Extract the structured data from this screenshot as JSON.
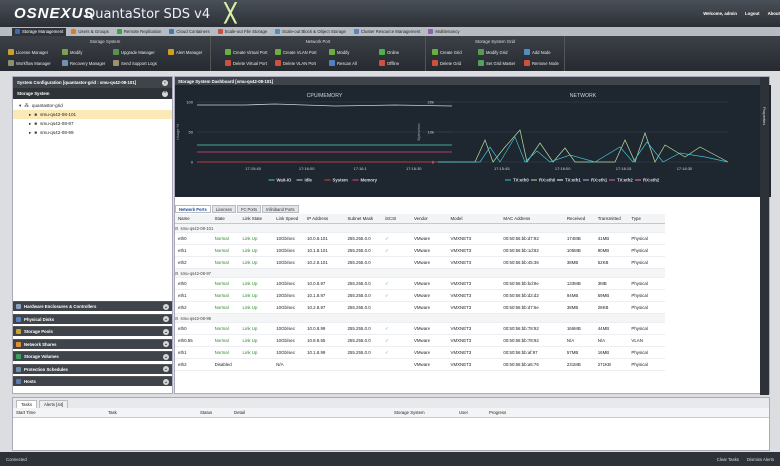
{
  "app": {
    "logo": "OSNEXUS",
    "title": "QuantaStor SDS v4",
    "welcome": "Welcome, admin",
    "logout": "Logout",
    "about": "About"
  },
  "ribbon_tabs": [
    "Storage Management",
    "Users & Groups",
    "Remote Replication",
    "Cloud Containers",
    "Scale-out File Storage",
    "Scale-out Block & Object Storage",
    "Cluster Resource Management",
    "Multitenancy"
  ],
  "ribbon": {
    "storage_system": {
      "title": "Storage System",
      "buttons": [
        "License Manager",
        "Modify",
        "Upgrade Manager",
        "Alert Manager",
        "Workflow Manager",
        "Recovery Manager",
        "Send Support Logs"
      ]
    },
    "network_port": {
      "title": "Network Port",
      "buttons": [
        "Create Virtual Port",
        "Create VLAN Port",
        "Modify",
        "Online",
        "Delete Virtual Port",
        "Delete VLAN Port",
        "Rescan All",
        "Offline"
      ]
    },
    "grid": {
      "title": "Storage System Grid",
      "buttons": [
        "Create Grid",
        "Modify Grid",
        "Add Node",
        "Delete Grid",
        "Set Grid Master",
        "Remove Node"
      ]
    }
  },
  "sidebar": {
    "title": "System Configuration [quantastor-grid : smu-qs42-08-101]",
    "section": "Storage System",
    "tree": [
      {
        "label": "quantastor-grid",
        "level": 0,
        "selected": false
      },
      {
        "label": "smu-qs42-08-101",
        "level": 1,
        "selected": true
      },
      {
        "label": "smu-qs42-08-97",
        "level": 1,
        "selected": false
      },
      {
        "label": "smu-qs42-08-99",
        "level": 1,
        "selected": false
      }
    ],
    "accordions": [
      "Hardware Enclosures & Controllers",
      "Physical Disks",
      "Storage Pools",
      "Network Shares",
      "Storage Volumes",
      "Protection Schedules",
      "Hosts"
    ]
  },
  "main": {
    "title": "Storage System Dashboard [smu-qs42-08-101]",
    "cpu_chart": {
      "title": "CPU/MEMORY",
      "ylabel": "Usage %",
      "yticks": [
        "100",
        "50",
        "0"
      ],
      "xticks": [
        "17:15:45",
        "17:16:00",
        "17:16:1",
        "17:16:30"
      ],
      "legend": [
        "Wait-IO",
        "Idle",
        "System",
        "Memory"
      ]
    },
    "net_chart": {
      "title": "NETWORK",
      "ylabel": "Bytes/sec",
      "yticks": [
        "20k",
        "10k",
        "0"
      ],
      "xticks": [
        "17:15:45",
        "17:16:00",
        "17:16:15",
        "17:16:30"
      ],
      "legend": [
        "TX:eth0",
        "RX:eth0",
        "TX:eth1",
        "RX:eth1",
        "TX:eth2",
        "RX:eth2"
      ]
    },
    "tabs": [
      "Network Ports",
      "Licenses",
      "FC Ports",
      "Infiniband Ports"
    ],
    "columns": [
      "Name",
      "State",
      "Link State",
      "Link Speed",
      "IP Address",
      "Subnet Mask",
      "iSCSI",
      "Vendor",
      "Model",
      "MAC Address",
      "Received",
      "Transmitted",
      "Type"
    ],
    "groups": [
      {
        "name": "smu-qs42-08-101",
        "rows": [
          [
            "eth0",
            "Normal",
            "Link Up",
            "10Gb/sec",
            "10.0.8.101",
            "255.255.0.0",
            "✓",
            "VMware",
            "VMXNET3",
            "00:50:56:bb:d7:92",
            "174MB",
            "41MB",
            "Physical"
          ],
          [
            "eth1",
            "Normal",
            "Link Up",
            "10Gb/sec",
            "10.1.8.101",
            "255.255.0.0",
            "✓",
            "VMware",
            "VMXNET3",
            "00:50:56:bb:1d:82",
            "105MB",
            "90MB",
            "Physical"
          ],
          [
            "eth2",
            "Normal",
            "Link Up",
            "10Gb/sec",
            "10.2.8.101",
            "255.255.0.0",
            "",
            "VMware",
            "VMXNET3",
            "00:50:56:bb:45:36",
            "38MB",
            "52KB",
            "Physical"
          ]
        ]
      },
      {
        "name": "smu-qs42-08-97",
        "rows": [
          [
            "eth0",
            "Normal",
            "Link Up",
            "10Gb/sec",
            "10.0.8.97",
            "255.255.0.0",
            "✓",
            "VMware",
            "VMXNET3",
            "00:50:56:bb:bd:9e",
            "133MB",
            "3MB",
            "Physical"
          ],
          [
            "eth1",
            "Normal",
            "Link Up",
            "10Gb/sec",
            "10.1.8.97",
            "255.255.0.0",
            "✓",
            "VMware",
            "VMXNET3",
            "00:50:56:bb:d2:d2",
            "94MB",
            "59MB",
            "Physical"
          ],
          [
            "eth2",
            "Normal",
            "Link Up",
            "10Gb/sec",
            "10.2.8.97",
            "255.255.0.0",
            "",
            "VMware",
            "VMXNET3",
            "00:50:56:bb:d7:6e",
            "38MB",
            "28KB",
            "Physical"
          ]
        ]
      },
      {
        "name": "smu-qs42-08-99",
        "rows": [
          [
            "eth0",
            "Normal",
            "Link Up",
            "10Gb/sec",
            "10.0.8.99",
            "255.255.0.0",
            "✓",
            "VMware",
            "VMXNET3",
            "00:50:56:bb:78:92",
            "166MB",
            "44MB",
            "Physical"
          ],
          [
            "eth0.55",
            "Normal",
            "Link Up",
            "10Gb/sec",
            "10.8.8.55",
            "255.255.0.0",
            "✓",
            "VMware",
            "VMXNET3",
            "00:50:56:bb:78:92",
            "N/A",
            "N/A",
            "VLAN"
          ],
          [
            "eth1",
            "Normal",
            "Link Up",
            "10Gb/sec",
            "10.1.8.99",
            "255.255.0.0",
            "✓",
            "VMware",
            "VMXNET3",
            "00:50:56:bb:af:97",
            "57MB",
            "16MB",
            "Physical"
          ],
          [
            "eth2",
            "Disabled",
            "",
            "N/A",
            "",
            "",
            "",
            "VMware",
            "VMXNET3",
            "00:50:56:bb:a5:76",
            "231MB",
            "271KB",
            "Physical"
          ]
        ]
      }
    ],
    "properties_label": "Properties"
  },
  "bottom": {
    "tabs": [
      "Tasks",
      "Alerts [44]"
    ],
    "columns": [
      "Start Time",
      "Task",
      "Status",
      "Detail",
      "Storage System",
      "User",
      "Progress"
    ]
  },
  "status": {
    "left": "Connected",
    "clear_tasks": "Clear Tasks",
    "dismiss_alerts": "Dismiss Alerts"
  }
}
